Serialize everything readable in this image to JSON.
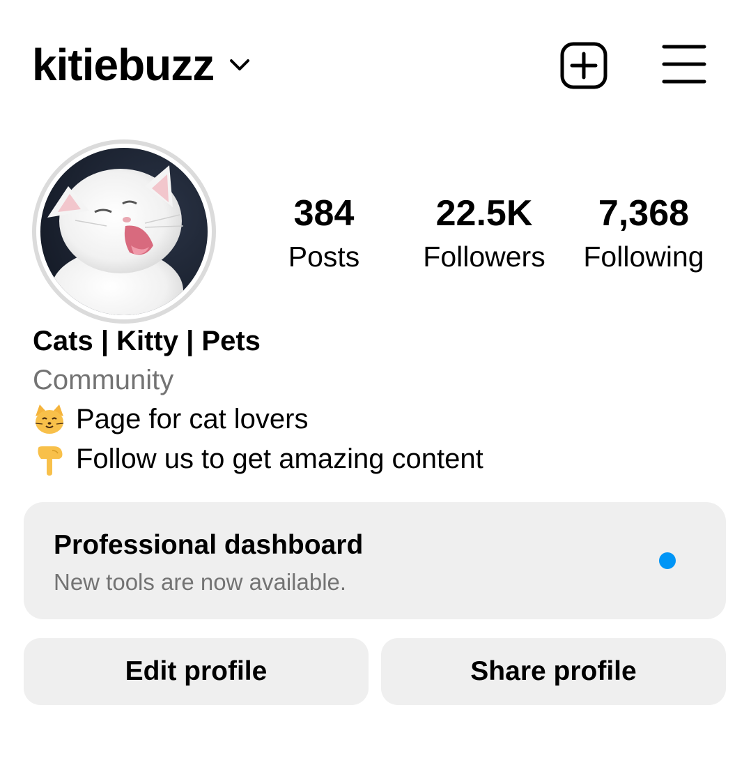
{
  "header": {
    "username": "kitiebuzz",
    "switch_account_icon": "chevron-down-icon",
    "create_icon": "plus-square-icon",
    "menu_icon": "hamburger-menu-icon"
  },
  "profile": {
    "avatar_alt": "white kitten yawning",
    "stats": [
      {
        "value": "384",
        "label": "Posts"
      },
      {
        "value": "22.5K",
        "label": "Followers"
      },
      {
        "value": "7,368",
        "label": "Following"
      }
    ],
    "bio": {
      "name": "Cats | Kitty | Pets",
      "category": "Community",
      "lines": [
        {
          "icon": "cat-face-emoji",
          "text": "Page for cat lovers"
        },
        {
          "icon": "pointing-down-emoji",
          "text": "Follow us to get amazing content"
        }
      ]
    }
  },
  "dashboard": {
    "title": "Professional dashboard",
    "subtitle": "New tools are now available.",
    "dot_color": "#0095f6"
  },
  "actions": {
    "edit_label": "Edit profile",
    "share_label": "Share profile"
  },
  "colors": {
    "secondary_text": "#737373",
    "button_bg": "#efefef",
    "accent": "#0095f6"
  }
}
